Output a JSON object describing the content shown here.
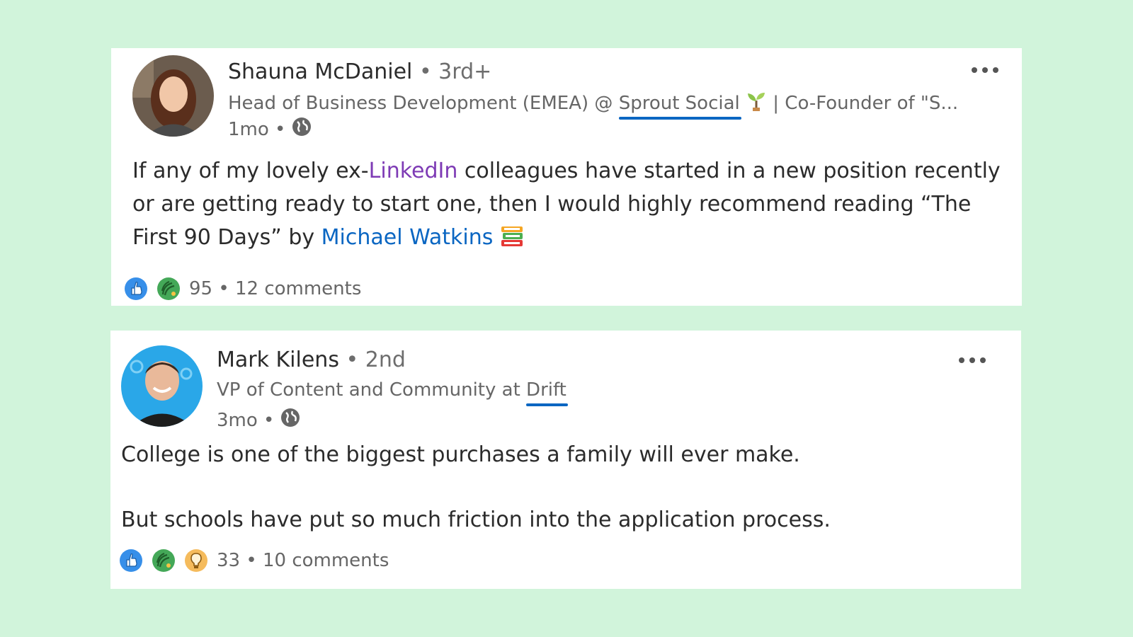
{
  "posts": [
    {
      "author": "Shauna McDaniel",
      "degree": "• 3rd+",
      "headline_prefix": "Head of Business Development (EMEA) @ ",
      "headline_link": "Sprout Social",
      "headline_suffix": " | Co-Founder of \"S...",
      "time": "1mo •",
      "body": {
        "t1": "If any of my lovely ex-",
        "mention1": "LinkedIn",
        "t2": " colleagues have started in a new position recently or are getting ready to start one, then I would highly recommend reading “The First 90 Days” by ",
        "mention2": "Michael Watkins"
      },
      "reaction_count": "95",
      "separator": " • ",
      "comments": "12 comments",
      "reaction_icons": [
        "like-icon",
        "celebrate-icon"
      ]
    },
    {
      "author": "Mark Kilens",
      "degree": "• 2nd",
      "headline_prefix": "VP of Content and Community at ",
      "headline_link": "Drift",
      "time": "3mo •",
      "body": {
        "p1": "College is one of the biggest purchases a family will ever make.",
        "p2": "But schools have put so much friction into the application process."
      },
      "reaction_count": "33",
      "separator": " • ",
      "comments": "10 comments",
      "reaction_icons": [
        "like-icon",
        "celebrate-icon",
        "insightful-icon"
      ]
    }
  ],
  "colors": {
    "background": "#d1f4db",
    "link_blue": "#0a66c2",
    "mention_purple": "#7e3bb5"
  }
}
